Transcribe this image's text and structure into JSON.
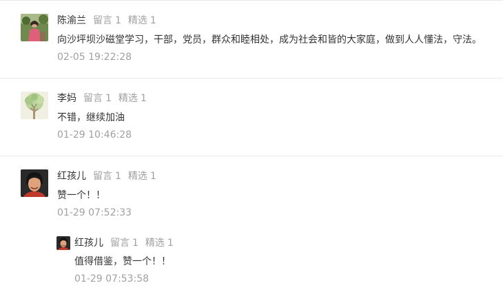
{
  "comments": [
    {
      "name": "陈渝兰",
      "messages_label": "留言",
      "messages_count": "1",
      "selected_label": "精选",
      "selected_count": "1",
      "text": "向沙坪坝沙磁堂学习，干部，党员，群众和睦相处，成为社会和皆的大家庭，做到人人懂法，守法。",
      "time": "02-05 19:22:28",
      "avatar_icon": "portrait-photo-outdoor"
    },
    {
      "name": "李妈",
      "messages_label": "留言",
      "messages_count": "1",
      "selected_label": "精选",
      "selected_count": "1",
      "text": "不错，继续加油",
      "time": "01-29 10:46:28",
      "avatar_icon": "tree-illustration"
    },
    {
      "name": "红孩儿",
      "messages_label": "留言",
      "messages_count": "1",
      "selected_label": "精选",
      "selected_count": "1",
      "text": "赞一个！！",
      "time": "01-29 07:52:33",
      "avatar_icon": "portrait-photo-dark"
    }
  ],
  "reply": {
    "name": "红孩儿",
    "messages_label": "留言",
    "messages_count": "1",
    "selected_label": "精选",
    "selected_count": "1",
    "text": "值得借鉴，赞一个！！",
    "time": "01-29 07:53:58",
    "avatar_icon": "portrait-photo-dark"
  },
  "colors": {
    "name": "#333333",
    "muted": "#a0a0a0",
    "divider": "#e8e8e8"
  }
}
